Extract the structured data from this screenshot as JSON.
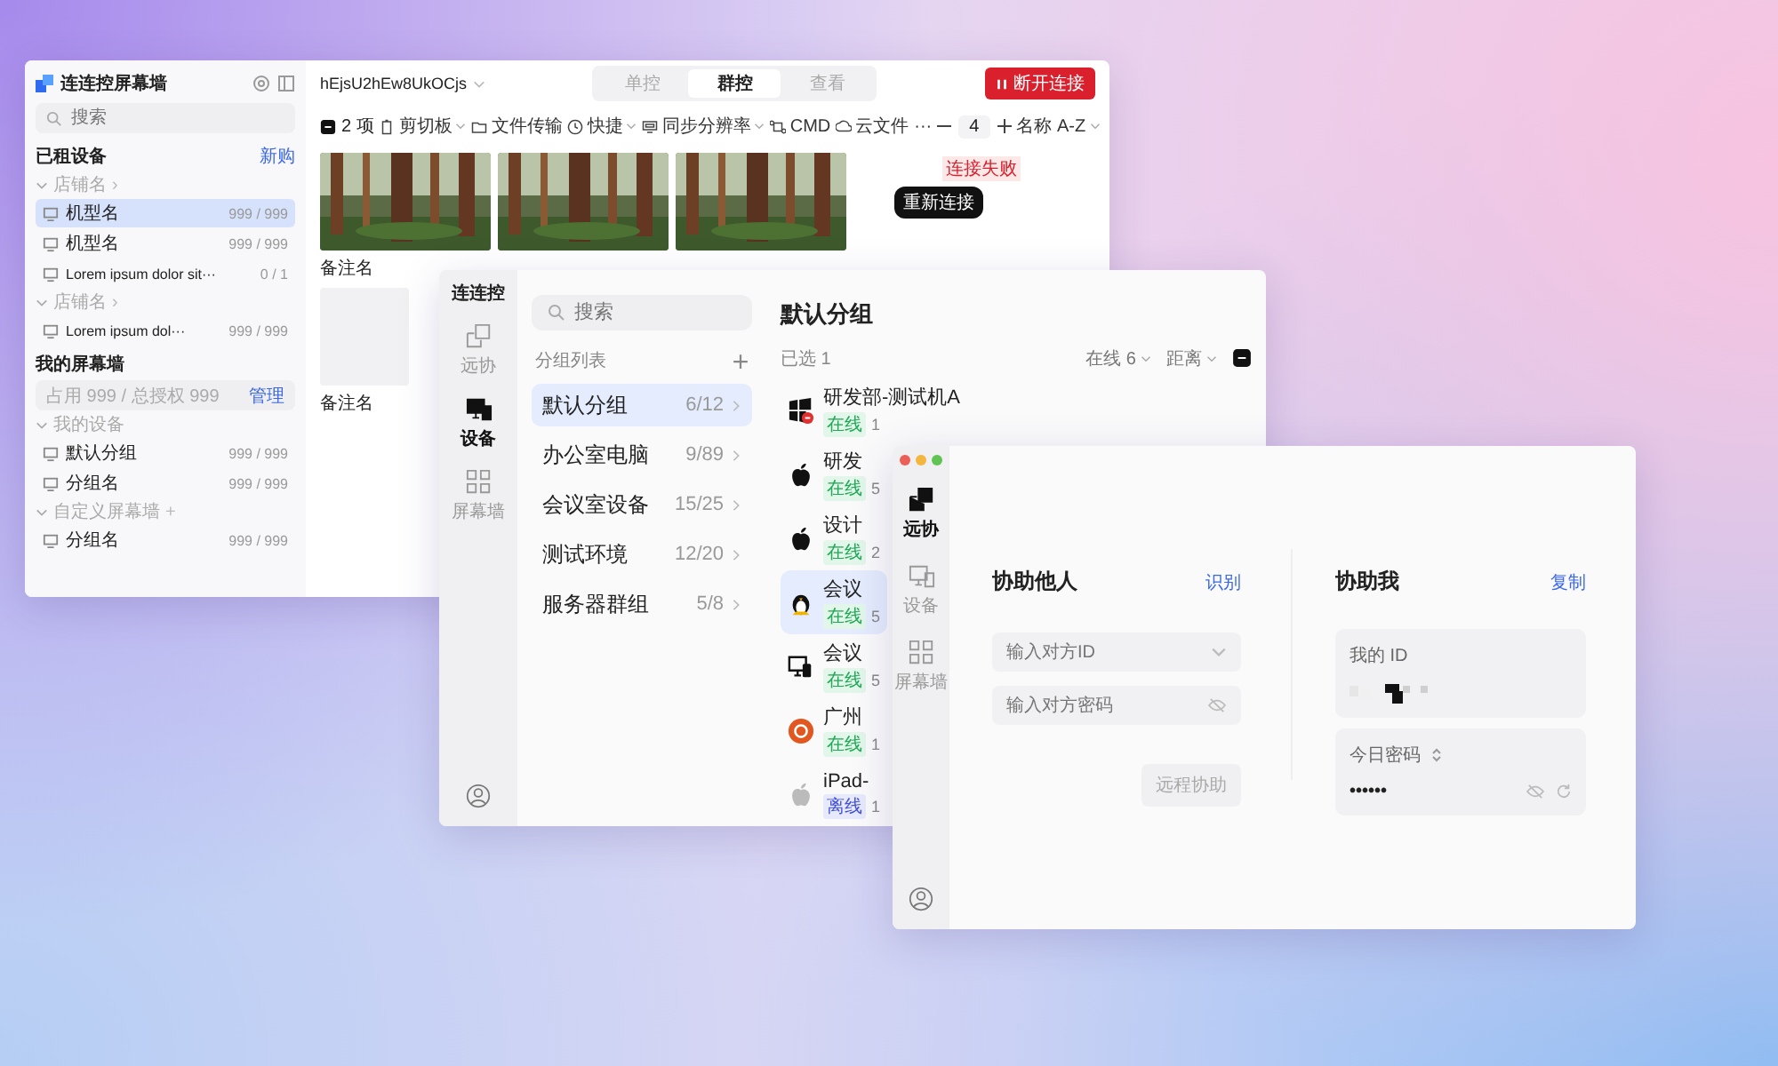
{
  "window_1": {
    "app_name": "连连控屏幕墙",
    "search": {
      "placeholder": "搜索"
    },
    "rented": {
      "title": "已租设备",
      "action": "新购",
      "groups": [
        {
          "label": "店铺名",
          "trailing": "›",
          "children": [
            {
              "label": "机型名",
              "count": "999 / 999",
              "selected": true
            },
            {
              "label": "机型名",
              "count": "999 / 999",
              "selected": false
            },
            {
              "label": "Lorem ipsum dolor sit···",
              "count": "0 / 1",
              "selected": false
            }
          ]
        },
        {
          "label": "店铺名",
          "trailing": "›",
          "children": [
            {
              "label": "Lorem ipsum dol···",
              "count": "999 / 999",
              "selected": false
            }
          ]
        }
      ]
    },
    "wall": {
      "title": "我的屏幕墙",
      "quota": "占用 999 / 总授权 999",
      "action": "管理",
      "groups": [
        {
          "label": "我的设备",
          "children": [
            {
              "label": "默认分组",
              "count": "999 / 999",
              "selected": false
            },
            {
              "label": "分组名",
              "count": "999 / 999",
              "selected": false
            }
          ]
        },
        {
          "label": "自定义屏幕墙",
          "trailing": "+",
          "children": [
            {
              "label": "分组名",
              "count": "999 / 999",
              "selected": false
            }
          ]
        }
      ]
    },
    "session": "hEjsU2hEw8UkOCjs",
    "modes": [
      {
        "label": "单控",
        "selected": false
      },
      {
        "label": "群控",
        "selected": true
      },
      {
        "label": "查看",
        "selected": false
      }
    ],
    "disconnect": "断开连接",
    "toolbar": [
      {
        "kind": "count",
        "label": "2 项"
      },
      {
        "kind": "menu",
        "label": "剪切板"
      },
      {
        "kind": "button",
        "label": "文件传输"
      },
      {
        "kind": "menu",
        "label": "快捷"
      },
      {
        "kind": "menu",
        "label": "同步分辨率"
      },
      {
        "kind": "button",
        "label": "CMD"
      },
      {
        "kind": "button",
        "label": "云文件"
      },
      {
        "kind": "more",
        "label": "···"
      }
    ],
    "columns": "4",
    "sort": "名称 A-Z",
    "screens": [
      {
        "kind": "picture",
        "caption": "备注名"
      },
      {
        "kind": "picture"
      },
      {
        "kind": "picture"
      },
      {
        "kind": "failed",
        "tag": "连接失败",
        "action": "重新连接"
      },
      {
        "kind": "empty",
        "caption": "备注名"
      }
    ]
  },
  "window_2": {
    "brand": "连连控",
    "nav": [
      {
        "label": "远协",
        "selected": false
      },
      {
        "label": "设备",
        "selected": true
      },
      {
        "label": "屏幕墙",
        "selected": false
      }
    ],
    "search": {
      "placeholder": "搜索"
    },
    "group_list_title": "分组列表",
    "groups": [
      {
        "name": "默认分组",
        "count": "6/12",
        "selected": true
      },
      {
        "name": "办公室电脑",
        "count": "9/89",
        "selected": false
      },
      {
        "name": "会议室设备",
        "count": "15/25",
        "selected": false
      },
      {
        "name": "测试环境",
        "count": "12/20",
        "selected": false
      },
      {
        "name": "服务器群组",
        "count": "5/8",
        "selected": false
      }
    ],
    "title": "默认分组",
    "selected_count": "已选 1",
    "filters": [
      "在线 6",
      "距离"
    ],
    "devices": [
      {
        "name": "研发部-测试机A",
        "kind": "windows",
        "status": "在线",
        "online": true,
        "count": "1",
        "selected": false
      },
      {
        "name": "研发",
        "kind": "apple",
        "status": "在线",
        "online": true,
        "count": "5",
        "selected": false
      },
      {
        "name": "设计",
        "kind": "apple",
        "status": "在线",
        "online": true,
        "count": "2",
        "selected": false
      },
      {
        "name": "会议",
        "kind": "linux",
        "status": "在线",
        "online": true,
        "count": "5",
        "selected": true
      },
      {
        "name": "会议",
        "kind": "monitor",
        "status": "在线",
        "online": true,
        "count": "5",
        "selected": false
      },
      {
        "name": "广州",
        "kind": "ubuntu",
        "status": "在线",
        "online": true,
        "count": "1",
        "selected": false
      },
      {
        "name": "iPad-",
        "kind": "apple",
        "status": "离线",
        "online": false,
        "count": "1",
        "selected": false
      }
    ]
  },
  "window_3": {
    "nav": [
      {
        "label": "远协",
        "selected": true
      },
      {
        "label": "设备",
        "selected": false
      },
      {
        "label": "屏幕墙",
        "selected": false
      }
    ],
    "assist_others": {
      "title": "协助他人",
      "action": "识别",
      "id_field": {
        "placeholder": "输入对方ID"
      },
      "password_field": {
        "placeholder": "输入对方密码"
      },
      "submit": {
        "label": "远程协助",
        "disabled": true
      }
    },
    "assist_me": {
      "title": "协助我",
      "action": "复制",
      "id_label": "我的 ID",
      "password_label": "今日密码",
      "password": "••••••"
    }
  }
}
